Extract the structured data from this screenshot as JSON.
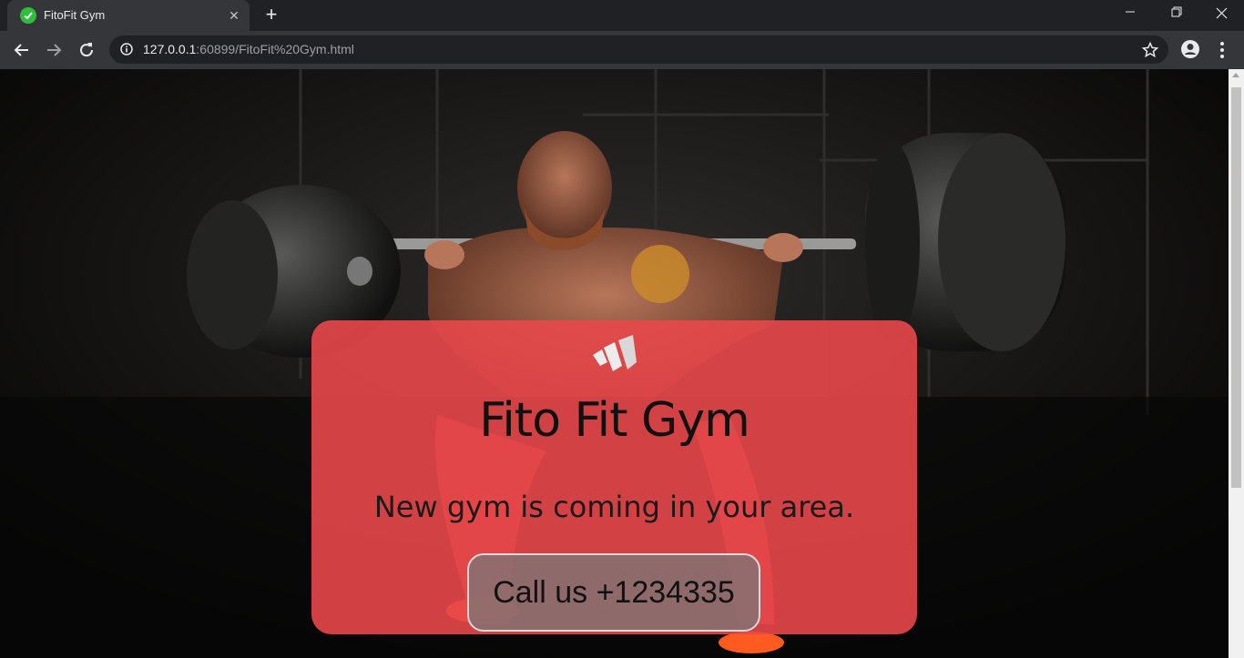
{
  "browser": {
    "tab_title": "FitoFit Gym",
    "url_host": "127.0.0.1",
    "url_rest": ":60899/FitoFit%20Gym.html",
    "new_tab_label": "+",
    "tab_close_label": "✕"
  },
  "hero": {
    "title": "Fito Fit Gym",
    "subtitle": "New gym is coming in your area.",
    "cta_label": "Call us +1234335"
  },
  "colors": {
    "card": "#e8484b",
    "browser_chrome": "#35363a",
    "favicon": "#2fbe3c"
  },
  "icons": [
    "check-icon",
    "close-icon",
    "plus-icon",
    "back-arrow-icon",
    "forward-arrow-icon",
    "reload-icon",
    "info-icon",
    "star-icon",
    "profile-icon",
    "kebab-menu-icon",
    "minimize-icon",
    "maximize-icon",
    "window-close-icon",
    "brand-logo-icon"
  ]
}
